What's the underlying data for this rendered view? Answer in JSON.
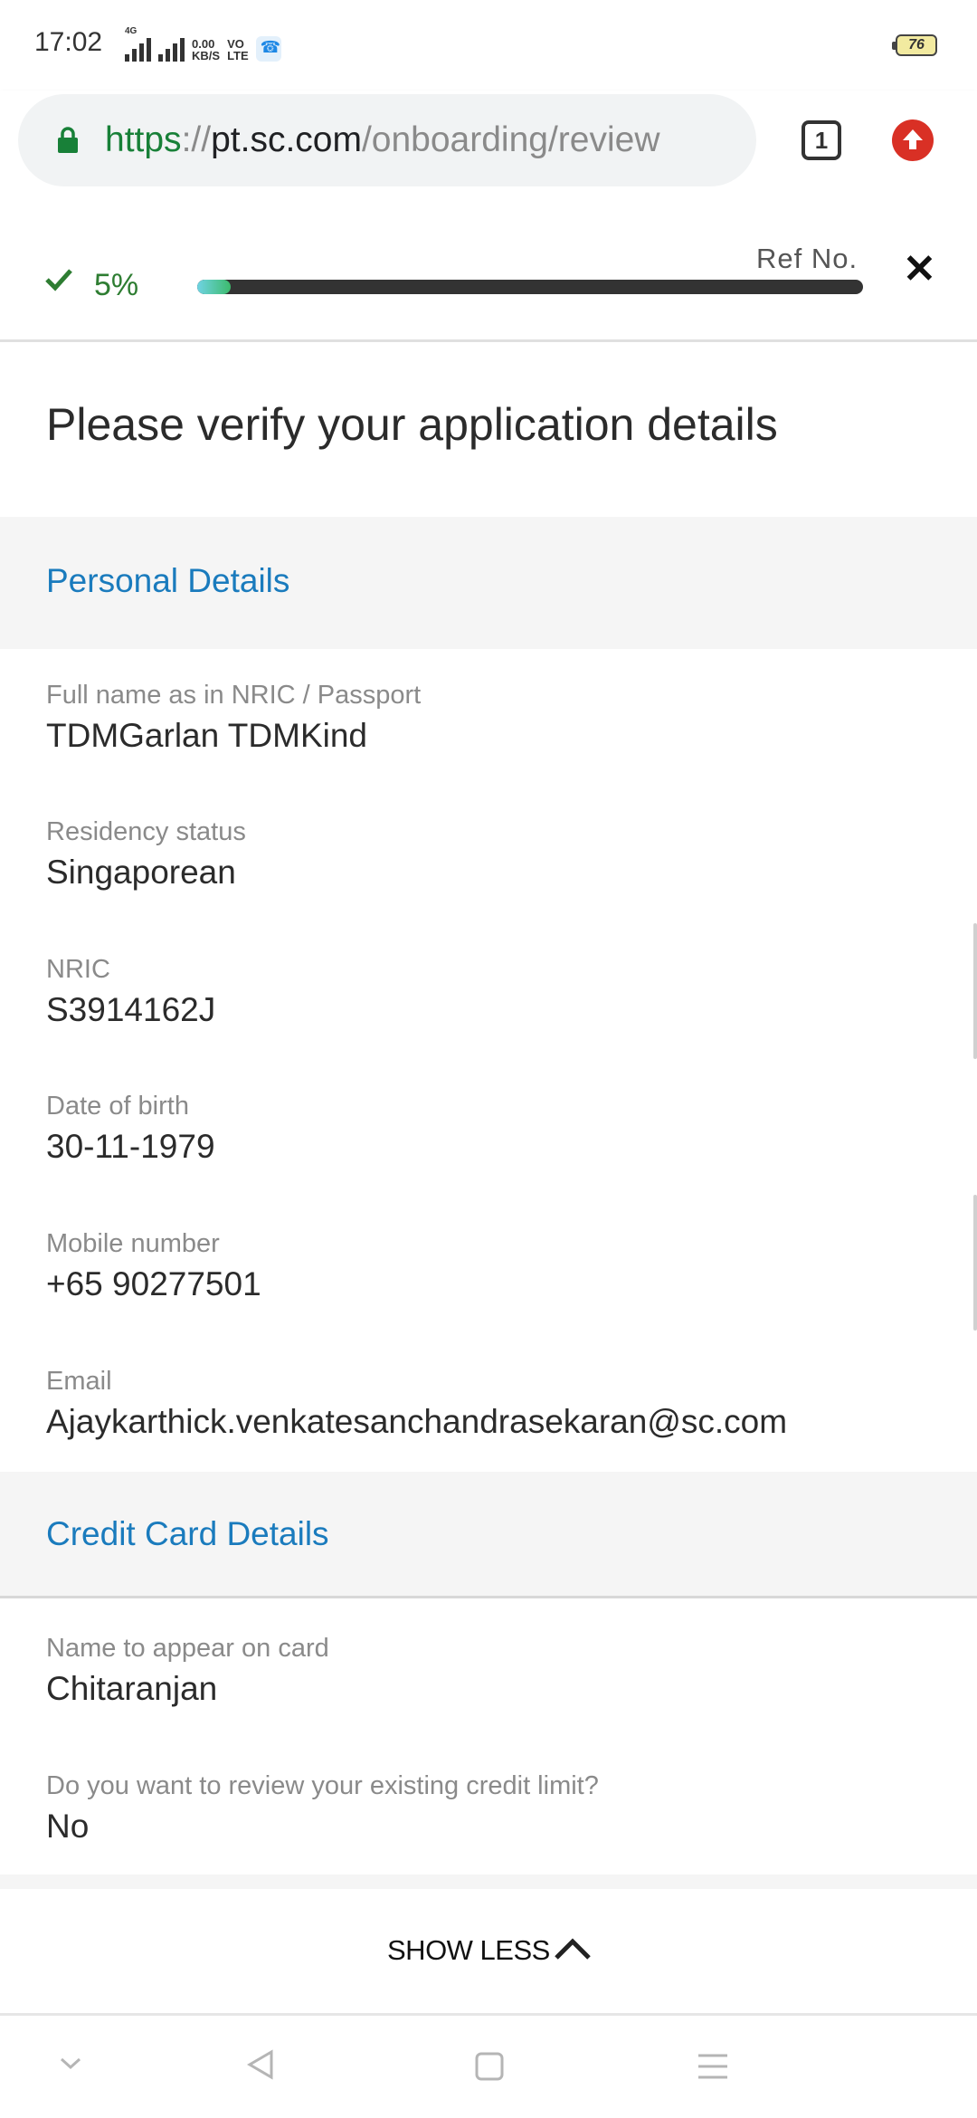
{
  "status_bar": {
    "time": "17:02",
    "network_label": "4G",
    "speed_value": "0.00",
    "speed_unit": "KB/S",
    "volte_top": "VO",
    "volte_bottom": "LTE",
    "battery": "76"
  },
  "browser": {
    "url_scheme": "https",
    "url_sep": "://",
    "url_host": "pt.sc.com",
    "url_path": "/onboarding/review",
    "tab_count": "1"
  },
  "progress": {
    "percent_label": "5%",
    "value_fraction": 0.05,
    "ref_label": "Ref No.",
    "close_glyph": "✕"
  },
  "page": {
    "title": "Please verify your application details"
  },
  "personal_details": {
    "heading": "Personal Details",
    "fields": [
      {
        "label": "Full name as in NRIC / Passport",
        "value": "TDMGarlan TDMKind"
      },
      {
        "label": "Residency status",
        "value": "Singaporean"
      },
      {
        "label": "NRIC",
        "value": "S3914162J"
      },
      {
        "label": "Date of birth",
        "value": "30-11-1979"
      },
      {
        "label": "Mobile number",
        "value": "+65 90277501"
      },
      {
        "label": "Email",
        "value": "Ajaykarthick.venkatesanchandrasekaran@sc.com"
      }
    ]
  },
  "credit_card_details": {
    "heading": "Credit Card Details",
    "fields": [
      {
        "label": "Name to appear on card",
        "value": "Chitaranjan"
      },
      {
        "label": "Do you want to review your existing credit limit?",
        "value": "No"
      }
    ]
  },
  "show_less": {
    "label": "SHOW LESS"
  },
  "icons": [
    "lock-icon",
    "tab-switcher-icon",
    "upload-icon",
    "check-icon",
    "close-icon",
    "chevron-up-icon",
    "nav-down-icon",
    "nav-back-icon",
    "nav-home-icon",
    "nav-menu-icon"
  ],
  "colors": {
    "link_blue": "#1a7bbd",
    "success_green": "#2e7d32",
    "progress_track": "#333333"
  }
}
